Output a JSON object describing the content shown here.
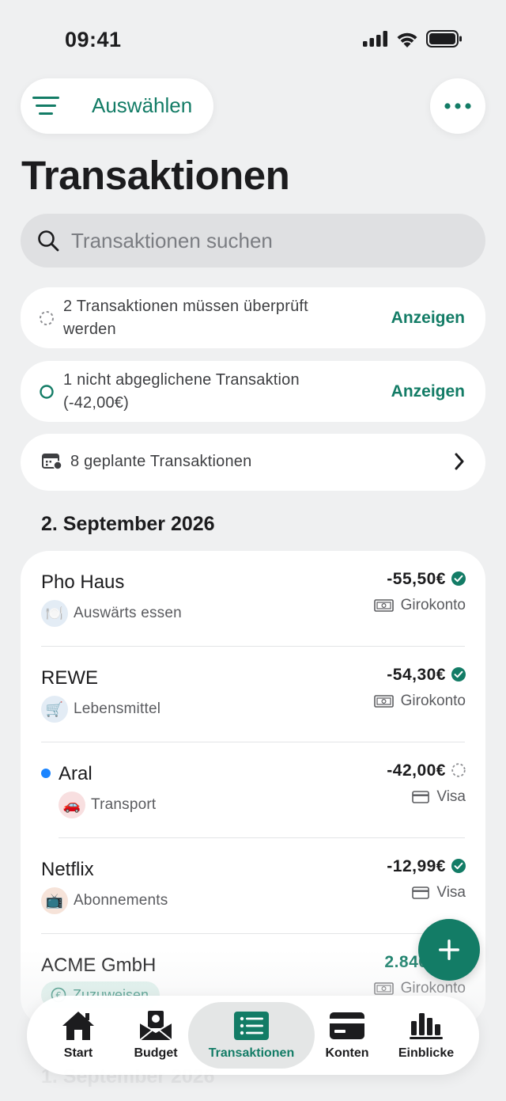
{
  "status_bar": {
    "time": "09:41"
  },
  "header": {
    "select_label": "Auswählen",
    "title": "Transaktionen"
  },
  "search": {
    "placeholder": "Transaktionen suchen"
  },
  "notices": {
    "review": {
      "text": "2 Transaktionen müssen überprüft werden",
      "action": "Anzeigen"
    },
    "unreconciled": {
      "text": "1 nicht abgeglichene Transaktion (-42,00€)",
      "action": "Anzeigen"
    },
    "scheduled": {
      "text": "8 geplante Transaktionen"
    }
  },
  "sections": [
    {
      "date": "2. September 2026",
      "transactions": [
        {
          "payee": "Pho Haus",
          "category": "Auswärts essen",
          "category_icon": "plate-icon",
          "amount": "-55,50€",
          "status": "cleared",
          "account": "Girokonto",
          "account_icon": "cash-icon"
        },
        {
          "payee": "REWE",
          "category": "Lebensmittel",
          "category_icon": "cart-icon",
          "amount": "-54,30€",
          "status": "cleared",
          "account": "Girokonto",
          "account_icon": "cash-icon"
        },
        {
          "payee": "Aral",
          "category": "Transport",
          "category_icon": "car-icon",
          "amount": "-42,00€",
          "status": "pending",
          "account": "Visa",
          "account_icon": "card-icon",
          "unread": true
        },
        {
          "payee": "Netflix",
          "category": "Abonnements",
          "category_icon": "tv-icon",
          "amount": "-12,99€",
          "status": "cleared",
          "account": "Visa",
          "account_icon": "card-icon"
        },
        {
          "payee": "ACME GmbH",
          "category": "Zuzuweisen",
          "category_icon": "euro-icon",
          "amount": "2.840,0",
          "status": "income",
          "account": "Girokonto",
          "account_icon": "cash-icon"
        }
      ]
    },
    {
      "date": "1. September 2026"
    }
  ],
  "tabs": [
    {
      "label": "Start",
      "icon": "house-icon"
    },
    {
      "label": "Budget",
      "icon": "envelope-icon"
    },
    {
      "label": "Transaktionen",
      "icon": "list-icon",
      "active": true
    },
    {
      "label": "Konten",
      "icon": "card-icon"
    },
    {
      "label": "Einblicke",
      "icon": "bar-chart-icon"
    }
  ],
  "colors": {
    "accent": "#137c66",
    "background": "#eff0f1",
    "unread": "#1a84ff"
  }
}
